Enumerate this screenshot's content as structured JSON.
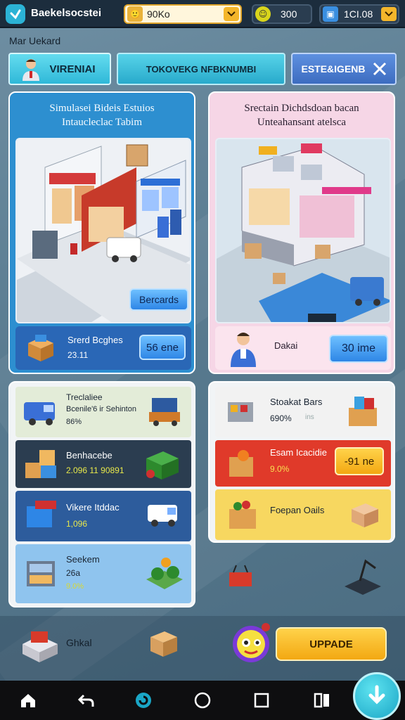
{
  "app": {
    "title": "Baekelsocstei"
  },
  "resources": {
    "coins": "90Ko",
    "gems": "300",
    "cash": "1CI.08"
  },
  "section_label": "Mar Uekard",
  "tabs": [
    {
      "label": "VIRENIAI"
    },
    {
      "label": "TOKOVEKG NFBKNUMBI"
    },
    {
      "label": "ESTE&IGENB"
    }
  ],
  "card_left": {
    "title_line1": "Simulasei Bideis Estuios",
    "title_line2": "Intaucleclac Tabim",
    "button": "Bercards",
    "footer_title": "Srerd Bcghes",
    "footer_value": "23.11",
    "footer_button": "56 ene"
  },
  "card_right": {
    "title_line1": "Srectain Dichdsdoan bacan",
    "title_line2": "Unteahansant atelsca",
    "footer_label": "Dakai",
    "footer_button": "30 ime"
  },
  "list_left": [
    {
      "title": "Treclaliee",
      "line2": "Bcenile'6 ir Sehinton",
      "value": "86%"
    },
    {
      "title": "Benhacebe",
      "value": "2.096 11 90891"
    },
    {
      "title": "Vikere Itddac",
      "value": "1,096"
    },
    {
      "title": "Seekem",
      "line2": "26a",
      "value": "9.0%"
    }
  ],
  "list_right": [
    {
      "title": "Stoakat Bars",
      "value": "690%",
      "extra": "ins"
    },
    {
      "title": "Esam Icacidie",
      "value": "9.0%",
      "button": "-91 ne"
    },
    {
      "title": "Foepan Oails"
    }
  ],
  "action_bar": {
    "label": "Ghkal",
    "upgrade": "UPPADE"
  },
  "colors": {
    "accent_teal": "#2fb8d8",
    "upgrade": "#f3a812",
    "card_blue": "#2d8fd0",
    "card_pink": "#f6d6e6"
  },
  "icons": [
    "home-icon",
    "back-icon",
    "app-icon",
    "circle-home-icon",
    "square-recents-icon",
    "split-icon",
    "download-icon"
  ]
}
